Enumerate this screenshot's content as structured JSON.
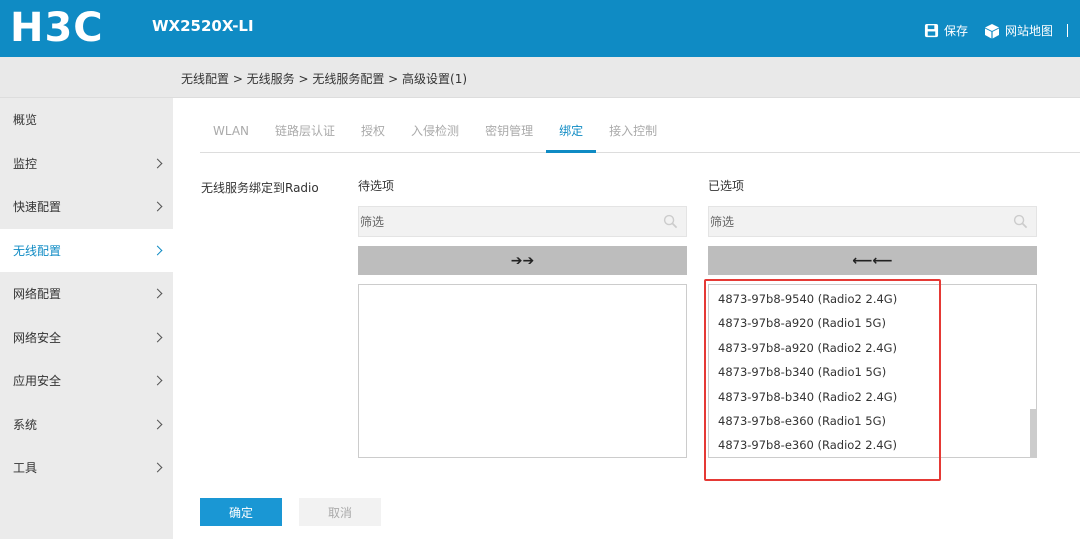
{
  "header": {
    "logo": "H3C",
    "model": "WX2520X-LI",
    "save_label": "保存",
    "sitemap_label": "网站地图"
  },
  "breadcrumb": "无线配置 > 无线服务 > 无线服务配置 > 高级设置(1)",
  "sidebar": {
    "items": [
      {
        "label": "概览",
        "chevron": false,
        "active": false
      },
      {
        "label": "监控",
        "chevron": true,
        "active": false
      },
      {
        "label": "快速配置",
        "chevron": true,
        "active": false
      },
      {
        "label": "无线配置",
        "chevron": true,
        "active": true
      },
      {
        "label": "网络配置",
        "chevron": true,
        "active": false
      },
      {
        "label": "网络安全",
        "chevron": true,
        "active": false
      },
      {
        "label": "应用安全",
        "chevron": true,
        "active": false
      },
      {
        "label": "系统",
        "chevron": true,
        "active": false
      },
      {
        "label": "工具",
        "chevron": true,
        "active": false
      }
    ]
  },
  "tabs": [
    {
      "label": "WLAN",
      "active": false
    },
    {
      "label": "链路层认证",
      "active": false
    },
    {
      "label": "授权",
      "active": false
    },
    {
      "label": "入侵检测",
      "active": false
    },
    {
      "label": "密钥管理",
      "active": false
    },
    {
      "label": "绑定",
      "active": true
    },
    {
      "label": "接入控制",
      "active": false
    }
  ],
  "form": {
    "field_label": "无线服务绑定到Radio",
    "available_title": "待选项",
    "selected_title": "已选项",
    "available_filter_placeholder": "筛选",
    "selected_filter_placeholder": "筛选",
    "add_all_symbol": "➔➔",
    "remove_all_symbol": "⟵⟵",
    "available_items": [],
    "selected_items": [
      "4873-97b8-9540 (Radio2 2.4G)",
      "4873-97b8-a920 (Radio1 5G)",
      "4873-97b8-a920 (Radio2 2.4G)",
      "4873-97b8-b340 (Radio1 5G)",
      "4873-97b8-b340 (Radio2 2.4G)",
      "4873-97b8-e360 (Radio1 5G)",
      "4873-97b8-e360 (Radio2 2.4G)"
    ]
  },
  "buttons": {
    "ok_label": "确定",
    "cancel_label": "取消"
  },
  "colors": {
    "header_bg": "#0f8bc4",
    "accent": "#0f8bc4",
    "highlight": "#e53935"
  }
}
